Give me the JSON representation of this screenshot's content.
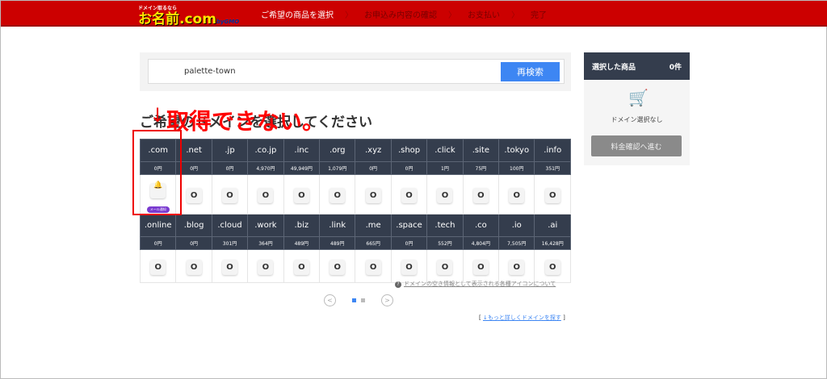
{
  "header": {
    "logo_tag": "ドメイン取るなら",
    "logo": "お名前.com",
    "logo_by": "byGMO",
    "steps": [
      "ご希望の商品を選択",
      "お申込み内容の確認",
      "お支払い",
      "完了"
    ]
  },
  "search": {
    "value": "palette-town",
    "button": "再検索"
  },
  "heading": "ご希望のドメインを選択してください",
  "annotation": "取得できない。",
  "annotation_arrow": "↓",
  "rows": [
    {
      "tlds": [
        ".com",
        ".net",
        ".jp",
        ".co.jp",
        ".inc",
        ".org",
        ".xyz",
        ".shop",
        ".click",
        ".site",
        ".tokyo",
        ".info"
      ],
      "prices": [
        "0円",
        "0円",
        "0円",
        "4,970円",
        "49,949円",
        "1,079円",
        "0円",
        "0円",
        "1円",
        "75円",
        "100円",
        "351円"
      ]
    },
    {
      "tlds": [
        ".online",
        ".blog",
        ".cloud",
        ".work",
        ".biz",
        ".link",
        ".me",
        ".space",
        ".tech",
        ".co",
        ".io",
        ".ai"
      ],
      "prices": [
        "0円",
        "0円",
        "301円",
        "364円",
        "489円",
        "489円",
        "665円",
        "0円",
        "552円",
        "4,804円",
        "7,505円",
        "16,428円"
      ]
    }
  ],
  "available_mark": "O",
  "mail_notify": "メール通知",
  "help_link": "ドメインの空き情報として表示される各種アイコンについて",
  "pager": {
    "prev": "<",
    "next": ">",
    "current": 1,
    "pages": 2
  },
  "more_link": "↓もっと詳しくドメインを探す",
  "sidebar": {
    "title": "選択した商品",
    "count": "0件",
    "empty": "ドメイン選択なし",
    "button": "料金確認へ進む"
  },
  "colors": {
    "header": "#cc0000",
    "accent": "#3d86f3",
    "table_head": "#343d4d",
    "annotation": "#ff0000"
  }
}
